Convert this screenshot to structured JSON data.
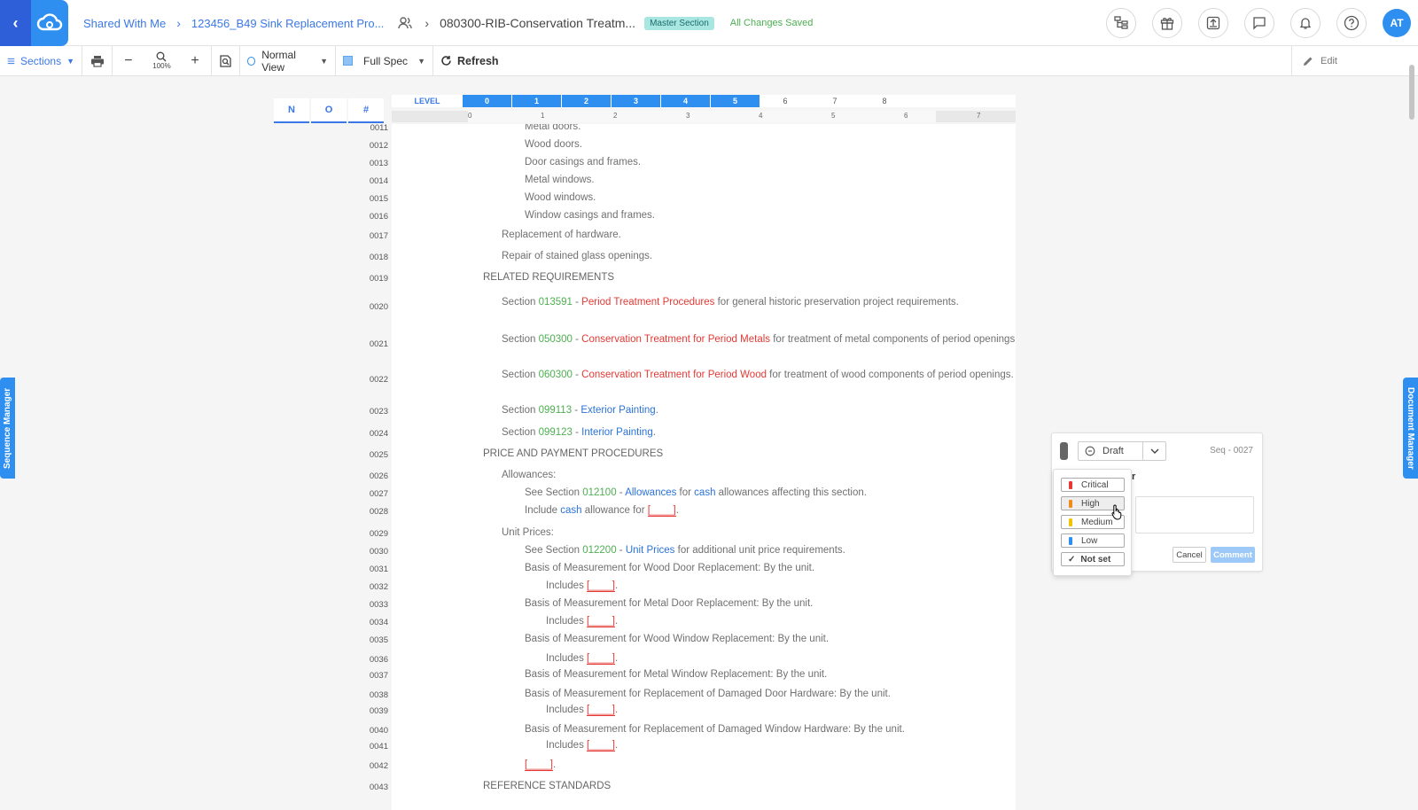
{
  "header": {
    "back_icon": "chevron-left",
    "logo_icon": "cloud-icon",
    "breadcrumb": [
      "Shared With Me",
      "123456_B49 Sink Replacement Pro...",
      "080300-RIB-Conservation Treatm..."
    ],
    "badge": "Master Section",
    "save_status": "All Changes Saved",
    "avatar_initials": "AT",
    "icons": [
      "hierarchy-icon",
      "gift-icon",
      "export-icon",
      "chat-icon",
      "bell-icon",
      "help-icon"
    ]
  },
  "toolbar": {
    "sections_label": "Sections",
    "zoom_level": "100%",
    "view_label": "Normal View",
    "spec_label": "Full Spec",
    "refresh_label": "Refresh",
    "edit_label": "Edit"
  },
  "side_tabs": {
    "left": "Sequence Manager",
    "right": "Document Manager"
  },
  "num_tabs": [
    "N",
    "O",
    "#"
  ],
  "level_ruler": {
    "label": "LEVEL",
    "levels": [
      "0",
      "1",
      "2",
      "3",
      "4",
      "5",
      "6",
      "7",
      "8"
    ],
    "active_levels": 6
  },
  "ruler_ticks": [
    "0",
    "1",
    "2",
    "3",
    "4",
    "5",
    "6",
    "7"
  ],
  "document": {
    "lines": [
      {
        "num": "0011",
        "indent": 3,
        "parts": [
          {
            "t": "Metal doors."
          }
        ]
      },
      {
        "num": "0012",
        "indent": 3,
        "parts": [
          {
            "t": "Wood doors."
          }
        ]
      },
      {
        "num": "0013",
        "indent": 3,
        "parts": [
          {
            "t": "Door casings and frames."
          }
        ]
      },
      {
        "num": "0014",
        "indent": 3,
        "parts": [
          {
            "t": "Metal windows."
          }
        ]
      },
      {
        "num": "0015",
        "indent": 3,
        "parts": [
          {
            "t": "Wood windows."
          }
        ]
      },
      {
        "num": "0016",
        "indent": 3,
        "parts": [
          {
            "t": "Window casings and frames."
          }
        ]
      },
      {
        "num": "0017",
        "indent": 2,
        "parts": [
          {
            "t": "Replacement of hardware."
          }
        ]
      },
      {
        "num": "0018",
        "indent": 2,
        "parts": [
          {
            "t": "Repair of stained glass openings."
          }
        ]
      },
      {
        "num": "0019",
        "indent": 1,
        "hdr": true,
        "parts": [
          {
            "t": "RELATED REQUIREMENTS"
          }
        ]
      },
      {
        "num": "0020",
        "indent": 2,
        "parts": [
          {
            "t": "Section "
          },
          {
            "t": "013591",
            "c": "green"
          },
          {
            "t": " - "
          },
          {
            "t": "Period Treatment Procedures",
            "c": "red"
          },
          {
            "t": " for general historic preservation project requirements."
          }
        ]
      },
      {
        "num": "0021",
        "indent": 2,
        "parts": [
          {
            "t": "Section "
          },
          {
            "t": "050300",
            "c": "green"
          },
          {
            "t": " - "
          },
          {
            "t": "Conservation Treatment for Period Metals",
            "c": "red"
          },
          {
            "t": " for treatment of metal components of period openings."
          }
        ]
      },
      {
        "num": "0022",
        "indent": 2,
        "parts": [
          {
            "t": "Section "
          },
          {
            "t": "060300",
            "c": "green"
          },
          {
            "t": " - "
          },
          {
            "t": "Conservation Treatment for Period Wood",
            "c": "red"
          },
          {
            "t": " for treatment of wood components of period openings."
          }
        ]
      },
      {
        "num": "0023",
        "indent": 2,
        "parts": [
          {
            "t": "Section "
          },
          {
            "t": "099113",
            "c": "green"
          },
          {
            "t": " - "
          },
          {
            "t": "Exterior Painting",
            "c": "blue"
          },
          {
            "t": "."
          }
        ]
      },
      {
        "num": "0024",
        "indent": 2,
        "parts": [
          {
            "t": "Section "
          },
          {
            "t": "099123",
            "c": "green"
          },
          {
            "t": " - "
          },
          {
            "t": "Interior Painting",
            "c": "blue"
          },
          {
            "t": "."
          }
        ]
      },
      {
        "num": "0025",
        "indent": 1,
        "hdr": true,
        "parts": [
          {
            "t": "PRICE AND PAYMENT PROCEDURES"
          }
        ]
      },
      {
        "num": "0026",
        "indent": 2,
        "parts": [
          {
            "t": "Allowances:"
          }
        ]
      },
      {
        "num": "0027",
        "indent": 3,
        "parts": [
          {
            "t": "See Section "
          },
          {
            "t": "012100",
            "c": "green"
          },
          {
            "t": " - "
          },
          {
            "t": "Allowances",
            "c": "blue"
          },
          {
            "t": " for "
          },
          {
            "t": "cash",
            "c": "blue"
          },
          {
            "t": " allowances affecting this section."
          }
        ]
      },
      {
        "num": "0028",
        "indent": 3,
        "parts": [
          {
            "t": "Include "
          },
          {
            "t": "cash",
            "c": "blue"
          },
          {
            "t": " allowance for "
          },
          {
            "t": "[____]",
            "c": "blank"
          },
          {
            "t": "."
          }
        ]
      },
      {
        "num": "0029",
        "indent": 2,
        "parts": [
          {
            "t": "Unit Prices:"
          }
        ]
      },
      {
        "num": "0030",
        "indent": 3,
        "parts": [
          {
            "t": "See Section "
          },
          {
            "t": "012200",
            "c": "green"
          },
          {
            "t": " - "
          },
          {
            "t": "Unit Prices",
            "c": "blue"
          },
          {
            "t": " for additional unit price requirements."
          }
        ]
      },
      {
        "num": "0031",
        "indent": 3,
        "parts": [
          {
            "t": "Basis of Measurement for Wood Door Replacement:  By the unit."
          }
        ]
      },
      {
        "num": "0032",
        "indent": 4,
        "parts": [
          {
            "t": "Includes "
          },
          {
            "t": "[____]",
            "c": "blank"
          },
          {
            "t": "."
          }
        ]
      },
      {
        "num": "0033",
        "indent": 3,
        "parts": [
          {
            "t": "Basis of Measurement for Metal Door Replacement:  By the unit."
          }
        ]
      },
      {
        "num": "0034",
        "indent": 4,
        "parts": [
          {
            "t": "Includes "
          },
          {
            "t": "[____]",
            "c": "blank"
          },
          {
            "t": "."
          }
        ]
      },
      {
        "num": "0035",
        "indent": 3,
        "parts": [
          {
            "t": "Basis of Measurement for Wood Window Replacement:  By the unit."
          }
        ]
      },
      {
        "num": "0036",
        "indent": 4,
        "parts": [
          {
            "t": "Includes "
          },
          {
            "t": "[____]",
            "c": "blank"
          },
          {
            "t": "."
          }
        ]
      },
      {
        "num": "0037",
        "indent": 3,
        "parts": [
          {
            "t": "Basis of Measurement for Metal Window Replacement:  By the unit."
          }
        ]
      },
      {
        "num": "0038",
        "indent": 3,
        "parts": [
          {
            "t": "Basis of Measurement for Replacement of Damaged Door Hardware:  By the unit."
          }
        ]
      },
      {
        "num": "0039",
        "indent": 4,
        "parts": [
          {
            "t": "Includes "
          },
          {
            "t": "[____]",
            "c": "blank"
          },
          {
            "t": "."
          }
        ]
      },
      {
        "num": "0040",
        "indent": 3,
        "parts": [
          {
            "t": "Basis of Measurement for Replacement of Damaged Window Hardware:  By the unit."
          }
        ]
      },
      {
        "num": "0041",
        "indent": 4,
        "parts": [
          {
            "t": "Includes "
          },
          {
            "t": "[____]",
            "c": "blank"
          },
          {
            "t": "."
          }
        ]
      },
      {
        "num": "0042",
        "indent": 3,
        "parts": [
          {
            "t": "[____]",
            "c": "blank"
          },
          {
            "t": "."
          }
        ]
      },
      {
        "num": "0043",
        "indent": 1,
        "hdr": true,
        "parts": [
          {
            "t": "REFERENCE STANDARDS"
          }
        ]
      }
    ]
  },
  "comment": {
    "status": "Draft",
    "seq": "Seq - 0027",
    "partial_text": "r",
    "cancel_label": "Cancel",
    "submit_label": "Comment",
    "priority_options": [
      {
        "label": "Critical",
        "color": "#e53935"
      },
      {
        "label": "High",
        "color": "#ef8c1a",
        "hover": true
      },
      {
        "label": "Medium",
        "color": "#f2c300"
      },
      {
        "label": "Low",
        "color": "#2f8ff0"
      },
      {
        "label": "Not set",
        "selected": true
      }
    ]
  },
  "colors": {
    "accent": "#2f8ff0",
    "link_green": "#4caf50",
    "link_red": "#e53935",
    "link_blue": "#2b73d9"
  }
}
